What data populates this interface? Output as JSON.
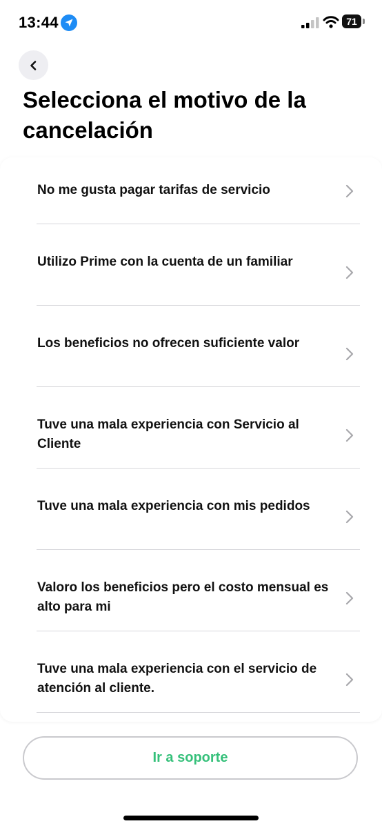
{
  "status_bar": {
    "time": "13:44",
    "battery": "71"
  },
  "header": {
    "title": "Selecciona el motivo de la cancelación"
  },
  "reasons": [
    {
      "label": "No me gusta pagar tarifas de servicio"
    },
    {
      "label": "Utilizo Prime con la cuenta de un familiar"
    },
    {
      "label": "Los beneficios no ofrecen suficiente valor"
    },
    {
      "label": "Tuve una mala experiencia con Servicio al Cliente"
    },
    {
      "label": "Tuve una mala experiencia con mis pedidos"
    },
    {
      "label": "Valoro los beneficios pero el costo mensual es alto para mi"
    },
    {
      "label": "Tuve una mala experiencia con el servicio de atención al cliente."
    }
  ],
  "support_button": {
    "label": "Ir a soporte"
  },
  "colors": {
    "accent": "#35c07a",
    "location_icon": "#1e8cf5"
  },
  "icons": [
    "location-arrow-icon",
    "signal-icon",
    "wifi-icon",
    "battery-icon",
    "back-chevron-icon",
    "chevron-right-icon"
  ]
}
